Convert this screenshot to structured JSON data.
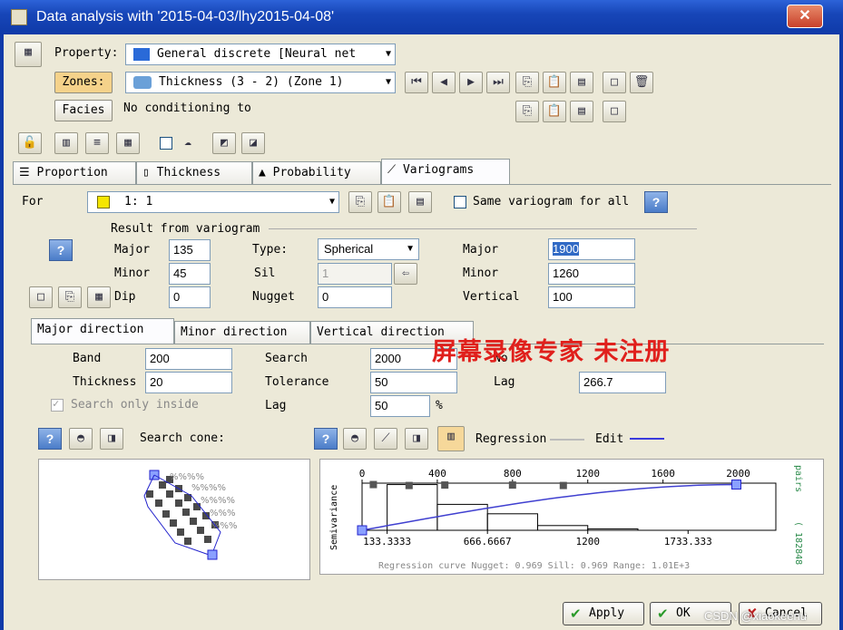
{
  "window": {
    "title": "Data analysis with '2015-04-03/lhy2015-04-08'",
    "close": "✕"
  },
  "property": {
    "label": "Property:",
    "value": "General discrete [Neural net"
  },
  "zones": {
    "label": "Zones:",
    "value": "Thickness (3 - 2) (Zone 1)"
  },
  "facies": {
    "label": "Facies",
    "value": "No conditioning to"
  },
  "tabs": [
    "Proportion",
    "Thickness",
    "Probability",
    "Variograms"
  ],
  "for": {
    "label": "For",
    "value": "1: 1",
    "same_label": "Same variogram for all"
  },
  "result": {
    "title": "Result from variogram",
    "major_label": "Major",
    "major": "135",
    "minor_label": "Minor",
    "minor": "45",
    "dip_label": "Dip",
    "dip": "0",
    "type_label": "Type:",
    "type": "Spherical",
    "sill_label": "Sil",
    "sill": "1",
    "nugget_label": "Nugget",
    "nugget": "0",
    "r_major_label": "Major",
    "r_major": "1900",
    "r_minor_label": "Minor",
    "r_minor": "1260",
    "vertical_label": "Vertical",
    "vertical": "100"
  },
  "subtabs": [
    "Major direction",
    "Minor direction",
    "Vertical direction"
  ],
  "direction": {
    "band_label": "Band",
    "band": "200",
    "thickness_label": "Thickness",
    "thickness": "20",
    "search_inside": "Search only inside",
    "search_label": "Search",
    "search": "2000",
    "tolerance_label": "Tolerance",
    "tolerance": "50",
    "lag_label": "Lag",
    "lag": "50",
    "percent": "%",
    "no_label": "No",
    "lag2_label": "Lag",
    "lag2": "266.7"
  },
  "search_cone": "Search cone:",
  "regression": {
    "regression_label": "Regression",
    "edit_label": "Edit"
  },
  "watermark": "屏幕录像专家  未注册",
  "chart_data": {
    "type": "scatter",
    "ylabel": "Semivariance",
    "right_label": "pairs",
    "right_value": "( 182848",
    "top_ticks": [
      "0",
      "400",
      "800",
      "1200",
      "1600",
      "2000"
    ],
    "top_tick_values": [
      0,
      400,
      800,
      1200,
      1600,
      2000
    ],
    "bottom_ticks": [
      "133.3333",
      "666.6667",
      "1200",
      "1733.333"
    ],
    "bottom_tick_values": [
      133.3333,
      666.6667,
      1200,
      1733.333
    ],
    "x_range": [
      0,
      2200
    ],
    "points": [
      {
        "x": 60,
        "y": 0.97
      },
      {
        "x": 250,
        "y": 0.95
      },
      {
        "x": 440,
        "y": 0.96
      },
      {
        "x": 800,
        "y": 0.96
      },
      {
        "x": 1070,
        "y": 0.95
      }
    ],
    "model_points": [
      {
        "x": 0,
        "y": 0.0
      },
      {
        "x": 1990,
        "y": 0.97
      }
    ],
    "histogram_edges": [
      133.3333,
      400,
      666.6667,
      933.3333,
      1200,
      1466.6667
    ],
    "histogram_heights": [
      0.97,
      0.55,
      0.35,
      0.1,
      0.03
    ],
    "footer": "Regression curve   Nugget: 0.969   Sill: 0.969   Range: 1.01E+3"
  },
  "buttons": {
    "apply": "Apply",
    "ok": "OK",
    "cancel": "Cancel"
  },
  "corner_watermark": "CSDN @xiaokeenu",
  "colors": {
    "titlebar": "#1746b8",
    "line": "#3a3adc",
    "watermark": "#e0201c"
  }
}
